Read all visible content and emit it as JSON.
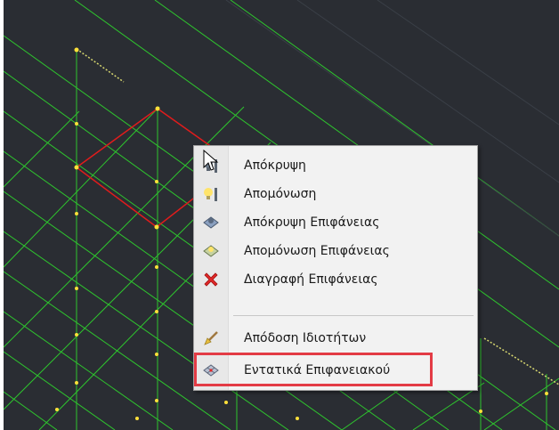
{
  "context_menu": {
    "items": [
      {
        "label": "Απόκρυψη",
        "icon": "hide-icon"
      },
      {
        "label": "Απομόνωση",
        "icon": "isolate-icon"
      },
      {
        "label": "Απόκρυψη Επιφάνειας",
        "icon": "hide-surface-icon"
      },
      {
        "label": "Απομόνωση Επιφάνειας",
        "icon": "isolate-surface-icon"
      },
      {
        "label": "Διαγραφή Επιφάνειας",
        "icon": "delete-icon"
      },
      {
        "label": "Απόδοση Ιδιοτήτων",
        "icon": "brush-icon"
      },
      {
        "label": "Εντατικά Επιφανειακού",
        "icon": "surface-stress-icon"
      }
    ]
  },
  "colors": {
    "viewport_bg": "#2a2d33",
    "grid_line": "#2ec52e",
    "node": "#ffe03a",
    "selected_edge": "#e01c1c",
    "highlight": "#e33b45"
  }
}
